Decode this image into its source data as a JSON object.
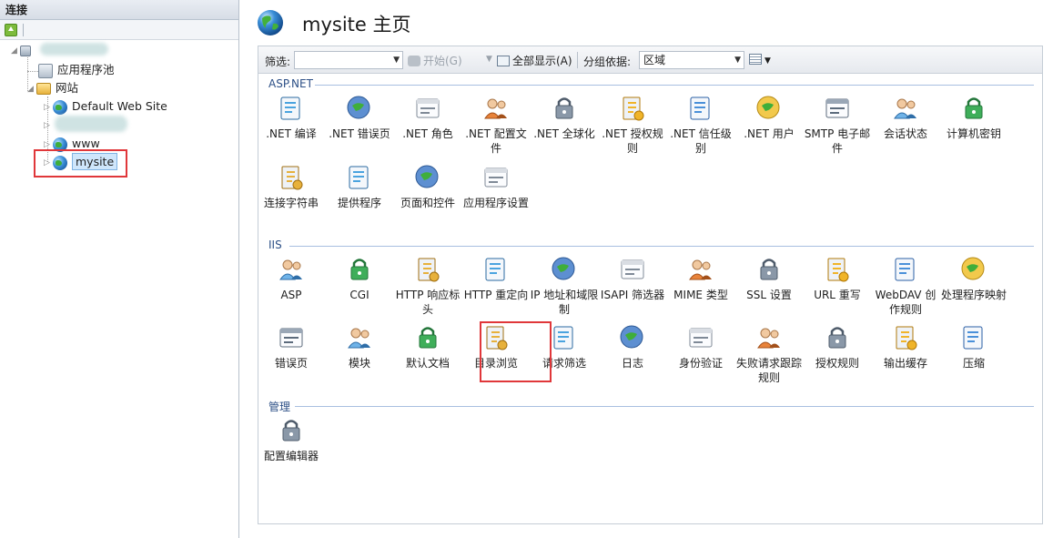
{
  "connections": {
    "header": "连接",
    "tree": {
      "app_pools": "应用程序池",
      "sites": "网站",
      "default_site": "Default Web Site",
      "www": "www",
      "mysite": "mysite"
    }
  },
  "page": {
    "title": "mysite 主页"
  },
  "filter_bar": {
    "filter_label": "筛选:",
    "filter_value": "",
    "go_label": "开始(G)",
    "show_all_label": "全部显示(A)",
    "group_by_label": "分组依据:",
    "group_by_value": "区域"
  },
  "sections": {
    "aspnet": {
      "title": "ASP.NET",
      "items": [
        {
          "label": ".NET 编译",
          "icon": "dotnet-compile-icon"
        },
        {
          "label": ".NET 错误页",
          "icon": "dotnet-error-pages-icon"
        },
        {
          "label": ".NET 角色",
          "icon": "dotnet-roles-icon"
        },
        {
          "label": ".NET 配置文件",
          "icon": "dotnet-profile-icon"
        },
        {
          "label": ".NET 全球化",
          "icon": "dotnet-globalization-icon"
        },
        {
          "label": ".NET 授权规则",
          "icon": "dotnet-authorization-icon"
        },
        {
          "label": ".NET 信任级别",
          "icon": "dotnet-trust-icon"
        },
        {
          "label": ".NET 用户",
          "icon": "dotnet-users-icon"
        },
        {
          "label": "SMTP 电子邮件",
          "icon": "smtp-email-icon"
        },
        {
          "label": "会话状态",
          "icon": "session-state-icon"
        },
        {
          "label": "计算机密钥",
          "icon": "machine-key-icon"
        },
        {
          "label": "连接字符串",
          "icon": "connection-strings-icon"
        },
        {
          "label": "提供程序",
          "icon": "providers-icon"
        },
        {
          "label": "页面和控件",
          "icon": "pages-controls-icon"
        },
        {
          "label": "应用程序设置",
          "icon": "app-settings-icon"
        }
      ]
    },
    "iis": {
      "title": "IIS",
      "items": [
        {
          "label": "ASP",
          "icon": "asp-icon"
        },
        {
          "label": "CGI",
          "icon": "cgi-icon"
        },
        {
          "label": "HTTP 响应标头",
          "icon": "http-headers-icon"
        },
        {
          "label": "HTTP 重定向",
          "icon": "http-redirect-icon"
        },
        {
          "label": "IP 地址和域限制",
          "icon": "ip-restrictions-icon"
        },
        {
          "label": "ISAPI 筛选器",
          "icon": "isapi-filters-icon"
        },
        {
          "label": "MIME 类型",
          "icon": "mime-types-icon"
        },
        {
          "label": "SSL 设置",
          "icon": "ssl-settings-icon"
        },
        {
          "label": "URL 重写",
          "icon": "url-rewrite-icon"
        },
        {
          "label": "WebDAV 创作规则",
          "icon": "webdav-icon"
        },
        {
          "label": "处理程序映射",
          "icon": "handler-mappings-icon"
        },
        {
          "label": "错误页",
          "icon": "error-pages-icon"
        },
        {
          "label": "模块",
          "icon": "modules-icon"
        },
        {
          "label": "默认文档",
          "icon": "default-document-icon"
        },
        {
          "label": "目录浏览",
          "icon": "directory-browsing-icon"
        },
        {
          "label": "请求筛选",
          "icon": "request-filtering-icon"
        },
        {
          "label": "日志",
          "icon": "logging-icon"
        },
        {
          "label": "身份验证",
          "icon": "authentication-icon"
        },
        {
          "label": "失败请求跟踪规则",
          "icon": "failed-request-tracing-icon"
        },
        {
          "label": "授权规则",
          "icon": "authorization-rules-icon"
        },
        {
          "label": "输出缓存",
          "icon": "output-caching-icon"
        },
        {
          "label": "压缩",
          "icon": "compression-icon"
        }
      ]
    },
    "management": {
      "title": "管理",
      "items": [
        {
          "label": "配置编辑器",
          "icon": "configuration-editor-icon"
        }
      ]
    }
  },
  "colors": {
    "highlight_red": "#e0373a",
    "section_blue": "#2c4f86",
    "selection_blue": "#cfe6fb"
  }
}
